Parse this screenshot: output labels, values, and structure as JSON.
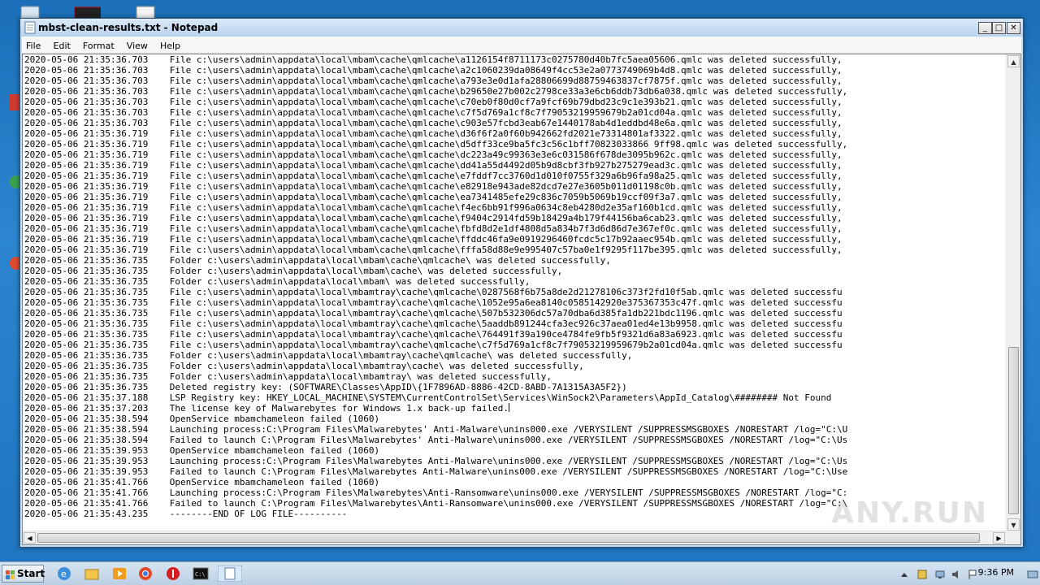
{
  "window": {
    "title": "mbst-clean-results.txt - Notepad",
    "controls": {
      "minimize": "_",
      "maximize": "□",
      "close": "✕"
    }
  },
  "menu": [
    "File",
    "Edit",
    "Format",
    "View",
    "Help"
  ],
  "log_lines": [
    "2020-05-06 21:35:36.703    File c:\\users\\admin\\appdata\\local\\mbam\\cache\\qmlcache\\a1126154f8711173c0275780d40b7fc5aea05606.qmlc was deleted successfully,",
    "2020-05-06 21:35:36.703    File c:\\users\\admin\\appdata\\local\\mbam\\cache\\qmlcache\\a2c1060239da08649f4cc53e2a0773749069b4d8.qmlc was deleted successfully,",
    "2020-05-06 21:35:36.703    File c:\\users\\admin\\appdata\\local\\mbam\\cache\\qmlcache\\a793e3e0d1afa28806699d88759463837cf7875f.qmlc was deleted successfully,",
    "2020-05-06 21:35:36.703    File c:\\users\\admin\\appdata\\local\\mbam\\cache\\qmlcache\\b29650e27b002c2798ce33a3e6cb6ddb73db6a038.qmlc was deleted successfully,",
    "2020-05-06 21:35:36.703    File c:\\users\\admin\\appdata\\local\\mbam\\cache\\qmlcache\\c70eb0f80d0cf7a9fcf69b79dbd23c9c1e393b21.qmlc was deleted successfully,",
    "2020-05-06 21:35:36.703    File c:\\users\\admin\\appdata\\local\\mbam\\cache\\qmlcache\\c7f5d769a1cf8c7f79053219959679b2a01cd04a.qmlc was deleted successfully,",
    "2020-05-06 21:35:36.703    File c:\\users\\admin\\appdata\\local\\mbam\\cache\\qmlcache\\c903e57fcbd3eab67e1440178ab4d1eddbd48e6a.qmlc was deleted successfully,",
    "2020-05-06 21:35:36.719    File c:\\users\\admin\\appdata\\local\\mbam\\cache\\qmlcache\\d36f6f2a0f60b942662fd2021e73314801af3322.qmlc was deleted successfully,",
    "2020-05-06 21:35:36.719    File c:\\users\\admin\\appdata\\local\\mbam\\cache\\qmlcache\\d5dff33ce9ba5fc3c56c1bff70823033866 9ff98.qmlc was deleted successfully,",
    "2020-05-06 21:35:36.719    File c:\\users\\admin\\appdata\\local\\mbam\\cache\\qmlcache\\dc223a49c99363e3e6c031586f678de3095b962c.qmlc was deleted successfully,",
    "2020-05-06 21:35:36.719    File c:\\users\\admin\\appdata\\local\\mbam\\cache\\qmlcache\\dd41a55d4492d05b9d8cbf3fb927b275279ead3c.qmlc was deleted successfully,",
    "2020-05-06 21:35:36.719    File c:\\users\\admin\\appdata\\local\\mbam\\cache\\qmlcache\\e7fddf7cc3760d1d010f0755f329a6b96fa98a25.qmlc was deleted successfully,",
    "2020-05-06 21:35:36.719    File c:\\users\\admin\\appdata\\local\\mbam\\cache\\qmlcache\\e82918e943ade82dcd7e27e3605b011d01198c0b.qmlc was deleted successfully,",
    "2020-05-06 21:35:36.719    File c:\\users\\admin\\appdata\\local\\mbam\\cache\\qmlcache\\ea7341485efe29c836c7059b5069b19ccf09f3a7.qmlc was deleted successfully,",
    "2020-05-06 21:35:36.719    File c:\\users\\admin\\appdata\\local\\mbam\\cache\\qmlcache\\f4ec6bb91f996a0634c8eb4280d2e35af160b1cd.qmlc was deleted successfully,",
    "2020-05-06 21:35:36.719    File c:\\users\\admin\\appdata\\local\\mbam\\cache\\qmlcache\\f9404c2914fd59b18429a4b179f44156ba6cab23.qmlc was deleted successfully,",
    "2020-05-06 21:35:36.719    File c:\\users\\admin\\appdata\\local\\mbam\\cache\\qmlcache\\fbfd8d2e1df4808d5a834b7f3d6d86d7e367ef0c.qmlc was deleted successfully,",
    "2020-05-06 21:35:36.719    File c:\\users\\admin\\appdata\\local\\mbam\\cache\\qmlcache\\ffddc46fa9e0919296460fcdc5c17b92aaec954b.qmlc was deleted successfully,",
    "2020-05-06 21:35:36.719    File c:\\users\\admin\\appdata\\local\\mbam\\cache\\qmlcache\\fffa58d88e9e995407c57ba0e1f9295f117be395.qmlc was deleted successfully,",
    "2020-05-06 21:35:36.735    Folder c:\\users\\admin\\appdata\\local\\mbam\\cache\\qmlcache\\ was deleted successfully,",
    "2020-05-06 21:35:36.735    Folder c:\\users\\admin\\appdata\\local\\mbam\\cache\\ was deleted successfully,",
    "2020-05-06 21:35:36.735    Folder c:\\users\\admin\\appdata\\local\\mbam\\ was deleted successfully,",
    "2020-05-06 21:35:36.735    File c:\\users\\admin\\appdata\\local\\mbamtray\\cache\\qmlcache\\0287568f6b75a8de2d21278106c373f2fd10f5ab.qmlc was deleted successfu",
    "2020-05-06 21:35:36.735    File c:\\users\\admin\\appdata\\local\\mbamtray\\cache\\qmlcache\\1052e95a6ea8140c0585142920e375367353c47f.qmlc was deleted successfu",
    "2020-05-06 21:35:36.735    File c:\\users\\admin\\appdata\\local\\mbamtray\\cache\\qmlcache\\507b532306dc57a70dba6d385fa1db221bdc1196.qmlc was deleted successfu",
    "2020-05-06 21:35:36.735    File c:\\users\\admin\\appdata\\local\\mbamtray\\cache\\qmlcache\\5aaddb891244cfa3ec926c37aea01ed4e13b9958.qmlc was deleted successfu",
    "2020-05-06 21:35:36.735    File c:\\users\\admin\\appdata\\local\\mbamtray\\cache\\qmlcache\\764491f39a190ce4784fe9fb5f9321d6a83a6923.qmlc was deleted successfu",
    "2020-05-06 21:35:36.735    File c:\\users\\admin\\appdata\\local\\mbamtray\\cache\\qmlcache\\c7f5d769a1cf8c7f79053219959679b2a01cd04a.qmlc was deleted successfu",
    "2020-05-06 21:35:36.735    Folder c:\\users\\admin\\appdata\\local\\mbamtray\\cache\\qmlcache\\ was deleted successfully,",
    "2020-05-06 21:35:36.735    Folder c:\\users\\admin\\appdata\\local\\mbamtray\\cache\\ was deleted successfully,",
    "2020-05-06 21:35:36.735    Folder c:\\users\\admin\\appdata\\local\\mbamtray\\ was deleted successfully,",
    "2020-05-06 21:35:36.735    Deleted registry key: (SOFTWARE\\Classes\\AppID\\{1F7896AD-8886-42CD-8ABD-7A1315A3A5F2})",
    "2020-05-06 21:35:37.188    LSP Registry key: HKEY_LOCAL_MACHINE\\SYSTEM\\CurrentControlSet\\Services\\WinSock2\\Parameters\\AppId_Catalog\\######## Not Found",
    "2020-05-06 21:35:37.203    The license key of Malwarebytes for Windows 1.x back-up failed.",
    "2020-05-06 21:35:38.594    OpenService mbamchameleon failed (1060)",
    "2020-05-06 21:35:38.594    Launching process:C:\\Program Files\\Malwarebytes' Anti-Malware\\unins000.exe /VERYSILENT /SUPPRESSMSGBOXES /NORESTART /log=\"C:\\U",
    "2020-05-06 21:35:38.594    Failed to launch C:\\Program Files\\Malwarebytes' Anti-Malware\\unins000.exe /VERYSILENT /SUPPRESSMSGBOXES /NORESTART /log=\"C:\\Us",
    "2020-05-06 21:35:39.953    OpenService mbamchameleon failed (1060)",
    "2020-05-06 21:35:39.953    Launching process:C:\\Program Files\\Malwarebytes Anti-Malware\\unins000.exe /VERYSILENT /SUPPRESSMSGBOXES /NORESTART /log=\"C:\\Us",
    "2020-05-06 21:35:39.953    Failed to launch C:\\Program Files\\Malwarebytes Anti-Malware\\unins000.exe /VERYSILENT /SUPPRESSMSGBOXES /NORESTART /log=\"C:\\Use",
    "2020-05-06 21:35:41.766    OpenService mbamchameleon failed (1060)",
    "2020-05-06 21:35:41.766    Launching process:C:\\Program Files\\Malwarebytes\\Anti-Ransomware\\unins000.exe /VERYSILENT /SUPPRESSMSGBOXES /NORESTART /log=\"C:",
    "2020-05-06 21:35:41.766    Failed to launch C:\\Program Files\\Malwarebytes\\Anti-Ransomware\\unins000.exe /VERYSILENT /SUPPRESSMSGBOXES /NORESTART /log=\"C:\\",
    "2020-05-06 21:35:43.235    --------END OF LOG FILE----------"
  ],
  "caret_line_index": 33,
  "watermark": "ANY.RUN",
  "taskbar": {
    "start_label": "Start",
    "clock": "9:36 PM"
  },
  "colors": {
    "window_frame": "#c9dff2",
    "taskbar": "#bcd0e4",
    "desktop": "#1f74bf"
  }
}
